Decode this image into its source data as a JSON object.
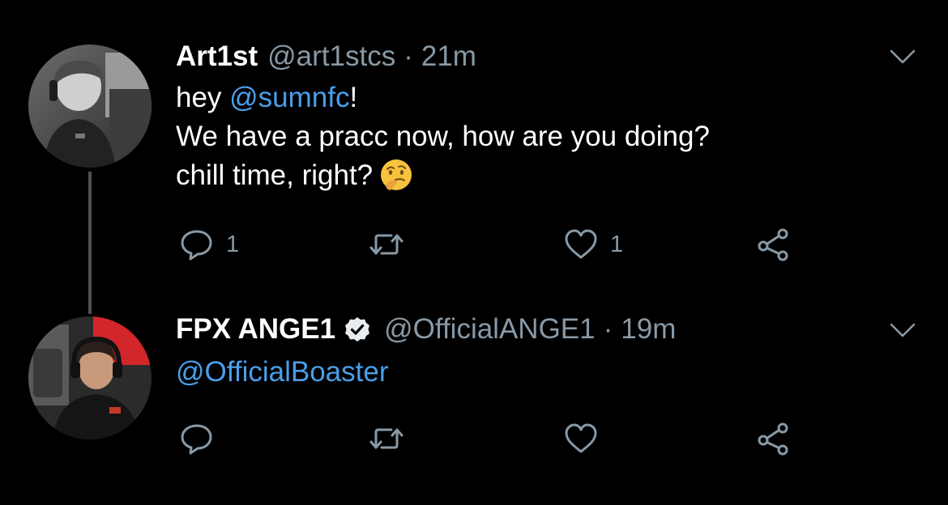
{
  "colors": {
    "background": "#000000",
    "text": "#ffffff",
    "muted": "#8899a6",
    "link": "#4a9ee8",
    "thread_line": "#4a5157"
  },
  "tweets": [
    {
      "display_name": "Art1st",
      "handle": "@art1stcs",
      "separator": "·",
      "time": "21m",
      "verified": false,
      "body": {
        "line1_prefix": "hey ",
        "line1_mention": "@sumnfc",
        "line1_suffix": "!",
        "line2": "We have a pracc now, how are you doing?",
        "line3": "chill time, right?",
        "emoji": "thinking-face"
      },
      "actions": {
        "reply_count": "1",
        "retweet_count": "",
        "like_count": "1"
      }
    },
    {
      "display_name": "FPX ANGE1",
      "handle": "@OfficialANGE1",
      "separator": "·",
      "time": "19m",
      "verified": true,
      "body": {
        "line1_mention": "@OfficialBoaster"
      },
      "actions": {
        "reply_count": "",
        "retweet_count": "",
        "like_count": ""
      }
    }
  ],
  "icons": {
    "reply": "reply-icon",
    "retweet": "retweet-icon",
    "like": "heart-icon",
    "share": "share-icon",
    "menu": "chevron-down-icon",
    "verified": "verified-badge-icon"
  }
}
